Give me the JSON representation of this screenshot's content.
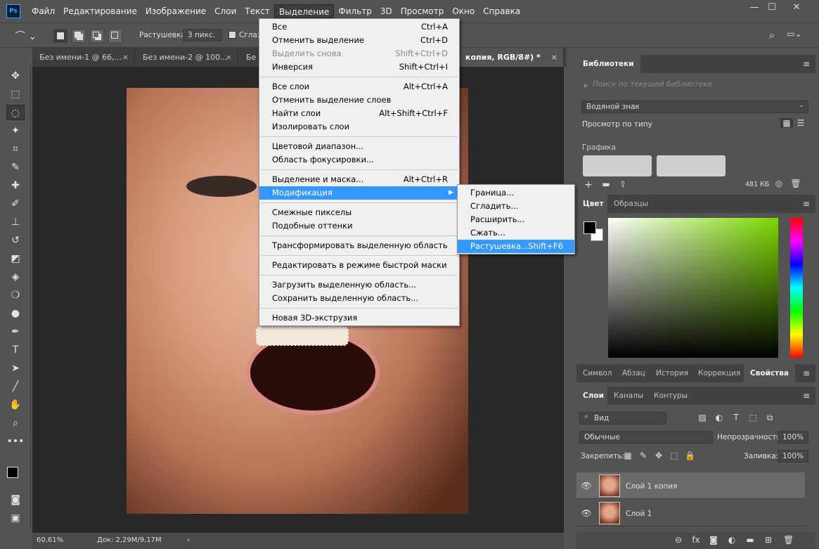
{
  "app": {
    "logo": "Ps"
  },
  "menubar": [
    "Файл",
    "Редактирование",
    "Изображение",
    "Слои",
    "Текст",
    "Выделение",
    "Фильтр",
    "3D",
    "Просмотр",
    "Окно",
    "Справка"
  ],
  "options": {
    "feather_label": "Растушевка:",
    "feather_value": "3 пикс.",
    "antialias_label": "Сглаж"
  },
  "tabs": [
    "Без имени-1 @ 66,...",
    "Без имени-2 @ 100...",
    "Бе",
    "копия, RGB/8#) *"
  ],
  "select_menu": {
    "groups": [
      [
        {
          "label": "Все",
          "sc": "Ctrl+A"
        },
        {
          "label": "Отменить выделение",
          "sc": "Ctrl+D"
        },
        {
          "label": "Выделить снова",
          "sc": "Shift+Ctrl+D",
          "disabled": true
        },
        {
          "label": "Инверсия",
          "sc": "Shift+Ctrl+I"
        }
      ],
      [
        {
          "label": "Все слои",
          "sc": "Alt+Ctrl+A"
        },
        {
          "label": "Отменить выделение слоев",
          "sc": ""
        },
        {
          "label": "Найти слои",
          "sc": "Alt+Shift+Ctrl+F"
        },
        {
          "label": "Изолировать слои",
          "sc": ""
        }
      ],
      [
        {
          "label": "Цветовой диапазон...",
          "sc": ""
        },
        {
          "label": "Область фокусировки...",
          "sc": ""
        }
      ],
      [
        {
          "label": "Выделение и маска...",
          "sc": "Alt+Ctrl+R"
        },
        {
          "label": "Модификация",
          "sc": "",
          "submenu": true,
          "hl": true
        }
      ],
      [
        {
          "label": "Смежные пикселы",
          "sc": ""
        },
        {
          "label": "Подобные оттенки",
          "sc": ""
        }
      ],
      [
        {
          "label": "Трансформировать выделенную область",
          "sc": ""
        }
      ],
      [
        {
          "label": "Редактировать в режиме быстрой маски",
          "sc": ""
        }
      ],
      [
        {
          "label": "Загрузить выделенную область...",
          "sc": ""
        },
        {
          "label": "Сохранить выделенную область...",
          "sc": ""
        }
      ],
      [
        {
          "label": "Новая 3D-экструзия",
          "sc": ""
        }
      ]
    ]
  },
  "modify_submenu": [
    {
      "label": "Граница...",
      "sc": ""
    },
    {
      "label": "Сгладить...",
      "sc": ""
    },
    {
      "label": "Расширить...",
      "sc": ""
    },
    {
      "label": "Сжать...",
      "sc": ""
    },
    {
      "label": "Растушевка...",
      "sc": "Shift+F6",
      "hl": true
    }
  ],
  "libraries": {
    "tab": "Библиотеки",
    "search_placeholder": "Поиск по текущей библиотеке",
    "library": "Водяной знак",
    "view": "Просмотр по типу",
    "section": "Графика",
    "size": "481 КБ"
  },
  "color_panel": {
    "tabs": [
      "Цвет",
      "Образцы"
    ]
  },
  "props_tabs": [
    "Символ",
    "Абзац",
    "История",
    "Коррекция",
    "Свойства"
  ],
  "layers_panel": {
    "tabs": [
      "Слои",
      "Каналы",
      "Контуры"
    ],
    "filter": "Вид",
    "blend": "Обычные",
    "opacity_label": "Непрозрачность:",
    "opacity": "100%",
    "lock_label": "Закрепить:",
    "fill_label": "Заливка:",
    "fill": "100%",
    "layers": [
      {
        "name": "Слой 1 копия"
      },
      {
        "name": "Слой 1"
      }
    ]
  },
  "status": {
    "zoom": "60,61%",
    "doc": "Док: 2,29M/9,17M"
  },
  "colors": {
    "accent": "#3399ff"
  }
}
